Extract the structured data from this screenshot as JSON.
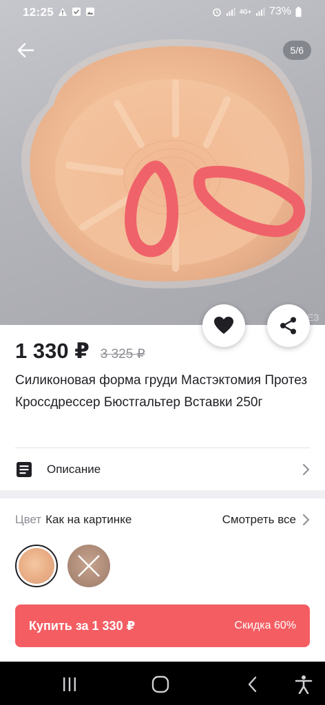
{
  "status_bar": {
    "time": "12:25",
    "battery": "73%",
    "network": "4G+",
    "left_icons": [
      "warning-icon",
      "checkbox-icon",
      "image-icon"
    ],
    "right_icons": [
      "alarm-icon",
      "signal-icon",
      "signal-icon",
      "battery-icon"
    ]
  },
  "gallery": {
    "counter": "5/6",
    "watermark": "E3"
  },
  "product": {
    "price": "1 330 ₽",
    "old_price": "3 325 ₽",
    "title": "Силиконовая форма груди Мастэктомия Протез Кроссдрессер Бюстгальтер Вставки 250г"
  },
  "description": {
    "label": "Описание"
  },
  "color": {
    "label": "Цвет",
    "value": "Как на картинке",
    "see_all": "Смотреть все"
  },
  "buy": {
    "label": "Купить за 1 330 ₽",
    "discount": "Скидка 60%"
  },
  "colors": {
    "accent": "#f45e63",
    "annotation": "#f0626a",
    "text": "#1f1f24",
    "muted": "#8c8c93"
  }
}
